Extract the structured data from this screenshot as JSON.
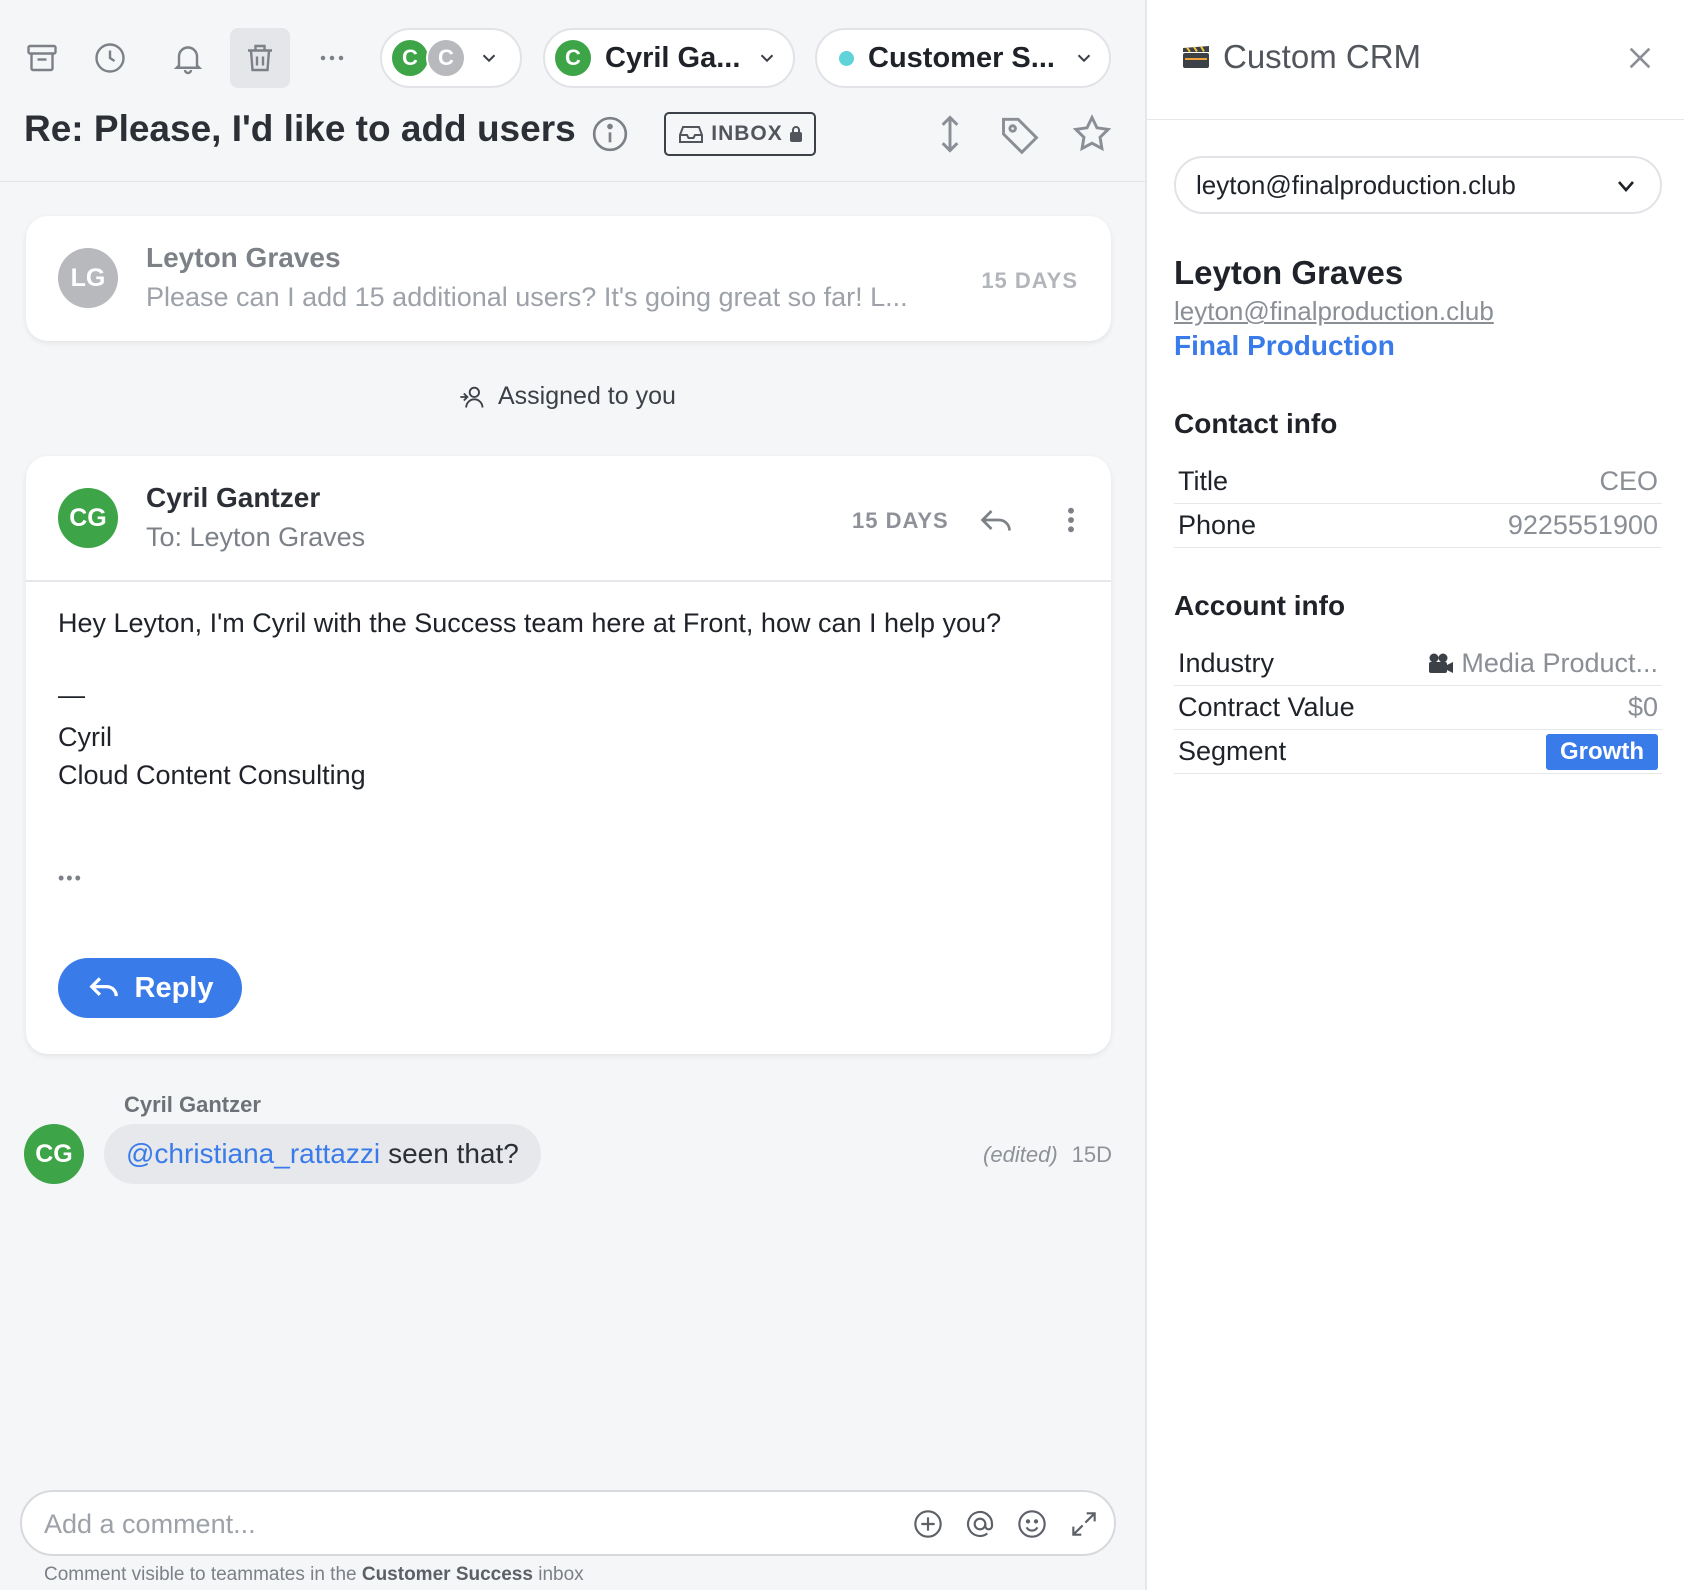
{
  "colors": {
    "accent": "#3a7bea",
    "assignee_green": "#3da547",
    "teammate_grey": "#b7b9bd",
    "inbox_dot": "#5fd3d8"
  },
  "toolbar": {
    "icons": [
      "archive-icon",
      "snooze-clock-icon",
      "bell-icon",
      "trash-icon",
      "more-horizontal-icon"
    ],
    "followers_initials": [
      "C",
      "C"
    ],
    "assignee": {
      "initial": "C",
      "name": "Cyril Ga..."
    },
    "inbox": {
      "name": "Customer S..."
    }
  },
  "conversation": {
    "subject": "Re: Please, I'd like to add users",
    "inbox_badge": "INBOX",
    "messages": [
      {
        "initials": "LG",
        "sender": "Leyton Graves",
        "preview": "Please can I add 15 additional users? It's going great so far! L...",
        "age": "15 DAYS"
      },
      {
        "initials": "CG",
        "sender": "Cyril Gantzer",
        "to": "To: Leyton Graves",
        "age": "15 DAYS",
        "body": "Hey Leyton, I'm Cyril with the Success team here at Front, how can I help you?",
        "sig_dash": "—",
        "sig_name": "Cyril",
        "sig_company": "Cloud Content Consulting",
        "ellipsis": "•••",
        "reply_label": "Reply"
      }
    ],
    "assigned_event": "Assigned to you",
    "comment": {
      "author": "Cyril Gantzer",
      "initials": "CG",
      "mention": "@christiana_rattazzi",
      "text": "seen that?",
      "edited": "(edited)",
      "age": "15D"
    },
    "composer": {
      "placeholder": "Add a comment...",
      "note_prefix": "Comment visible to teammates in the",
      "note_inbox": "Customer Success",
      "note_suffix": "inbox"
    }
  },
  "crm": {
    "title": "Custom CRM",
    "selected_contact": "leyton@finalproduction.club",
    "name": "Leyton Graves",
    "email": "leyton@finalproduction.club",
    "company": "Final Production",
    "contact_section": "Contact info",
    "contact_rows": [
      {
        "label": "Title",
        "value": "CEO"
      },
      {
        "label": "Phone",
        "value": "9225551900"
      }
    ],
    "account_section": "Account info",
    "account_rows": [
      {
        "label": "Industry",
        "value": "Media Product...",
        "icon": "movie-camera-icon"
      },
      {
        "label": "Contract Value",
        "value": "$0"
      },
      {
        "label": "Segment",
        "value": "Growth"
      }
    ]
  }
}
